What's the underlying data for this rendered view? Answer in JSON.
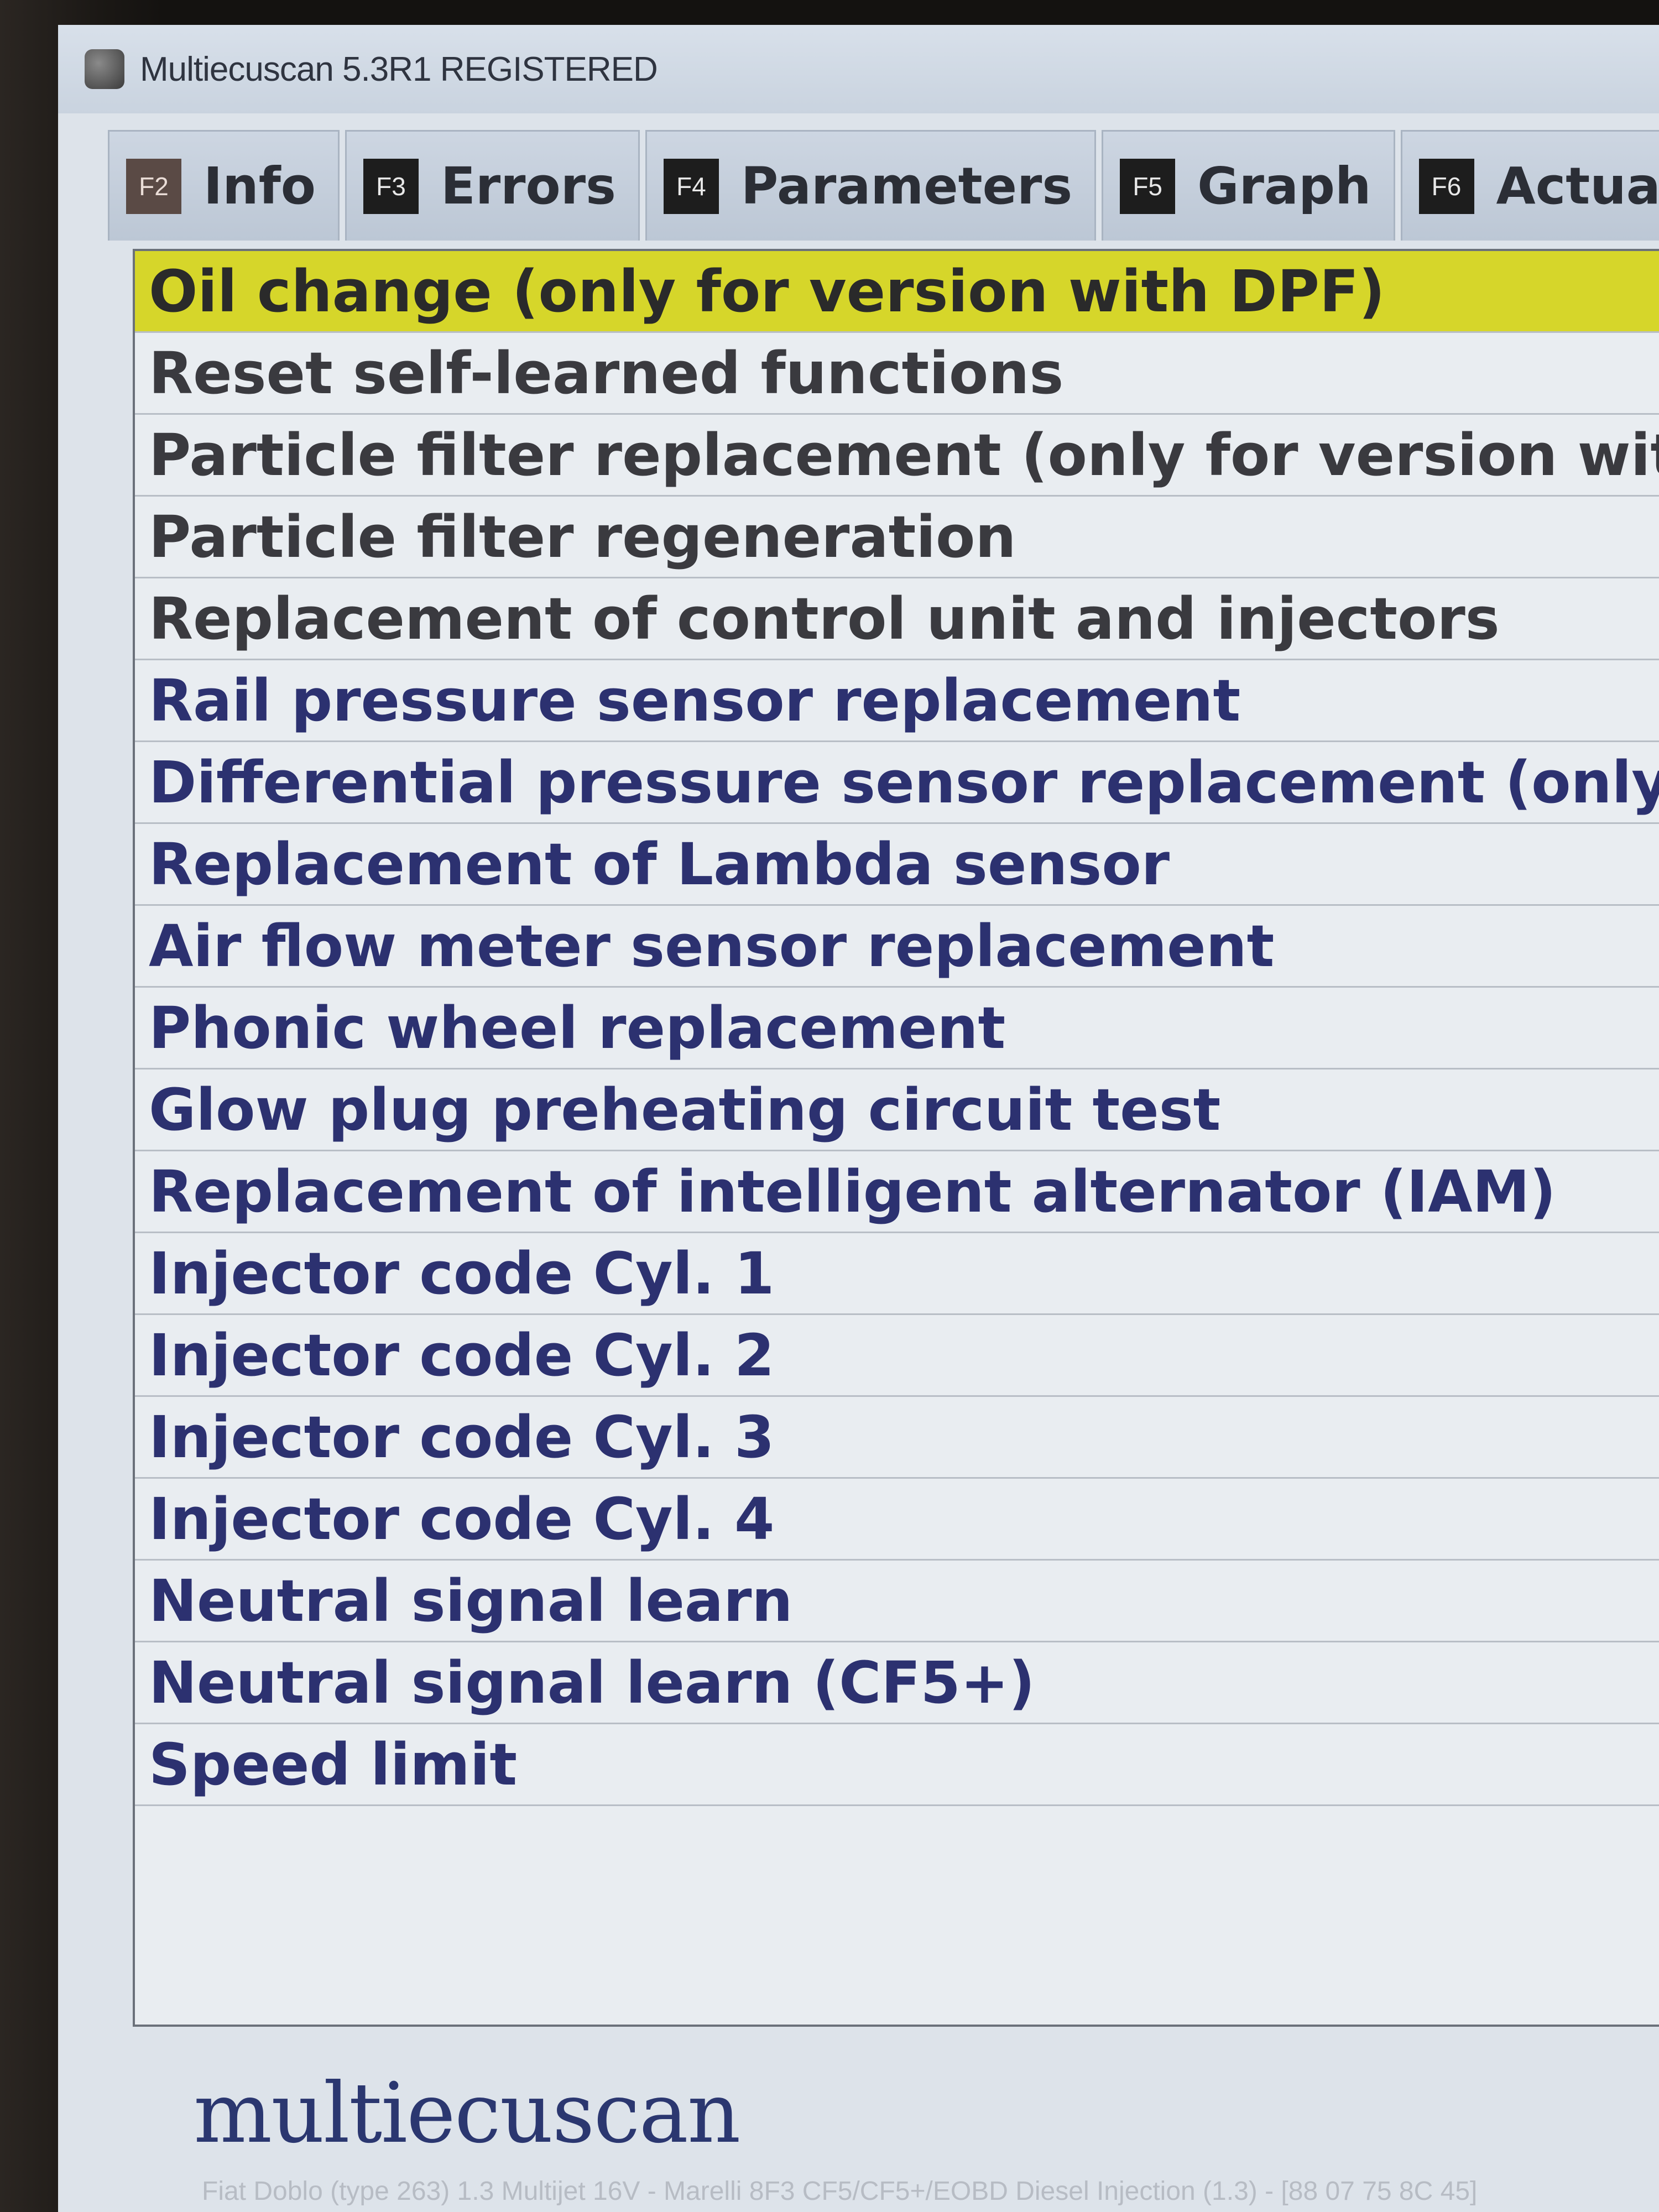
{
  "window": {
    "title": "Multiecuscan 5.3R1 REGISTERED"
  },
  "tabs": [
    {
      "key": "F2",
      "label": "Info"
    },
    {
      "key": "F3",
      "label": "Errors"
    },
    {
      "key": "F4",
      "label": "Parameters"
    },
    {
      "key": "F5",
      "label": "Graph"
    },
    {
      "key": "F6",
      "label": "Actuat"
    }
  ],
  "procedures": {
    "selected_index": 0,
    "items": [
      "Oil change (only for version with DPF)",
      "Reset self-learned functions",
      "Particle filter replacement (only for version with DF",
      "Particle filter regeneration",
      "Replacement of control unit and injectors",
      "Rail pressure sensor replacement",
      "Differential pressure sensor replacement (only for v",
      "Replacement of Lambda sensor",
      "Air flow meter sensor replacement",
      "Phonic wheel replacement",
      "Glow plug preheating circuit test",
      "Replacement of intelligent alternator (IAM)",
      "Injector code Cyl. 1",
      "Injector code Cyl. 2",
      "Injector code Cyl. 3",
      "Injector code Cyl. 4",
      "Neutral signal learn",
      "Neutral signal learn (CF5+)",
      "Speed limit"
    ]
  },
  "footer": {
    "logo": "multiecuscan",
    "status": "Fiat Doblo (type 263) 1.3 Multijet 16V - Marelli 8F3 CF5/CF5+/EOBD Diesel Injection (1.3) - [88 07 75 8C 45]"
  },
  "colors": {
    "selected_row": "#d6d62a",
    "item_text": "#2c3170",
    "logo": "#2b3770"
  }
}
